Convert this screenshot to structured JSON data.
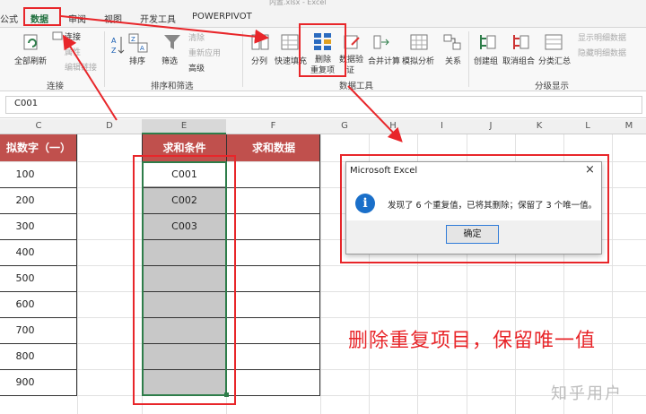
{
  "window": {
    "title": "内置.xlsx - Excel"
  },
  "tabs": [
    "公式",
    "数据",
    "审阅",
    "视图",
    "开发工具",
    "POWERPIVOT"
  ],
  "ribbon": {
    "connections": {
      "refresh_all": "全部刷新",
      "connections": "连接",
      "properties": "属性",
      "edit_links": "编辑链接",
      "group_label": "连接"
    },
    "sort_filter": {
      "sort": "排序",
      "filter": "筛选",
      "clear": "清除",
      "reapply": "重新应用",
      "advanced": "高级",
      "group_label": "排序和筛选"
    },
    "data_tools": {
      "text_to_columns": "分列",
      "flash_fill": "快速填充",
      "remove_duplicates_1": "删除",
      "remove_duplicates_2": "重复项",
      "data_validation_1": "数据验",
      "data_validation_2": "证",
      "consolidate": "合并计算",
      "what_if": "模拟分析",
      "relationships": "关系",
      "group_label": "数据工具"
    },
    "outline": {
      "group": "创建组",
      "ungroup": "取消组合",
      "subtotal": "分类汇总",
      "show_detail": "显示明细数据",
      "hide_detail": "隐藏明细数据",
      "group_label": "分级显示"
    }
  },
  "formula_bar": {
    "value": "C001"
  },
  "columns": [
    "C",
    "D",
    "E",
    "F",
    "G",
    "H",
    "I",
    "J",
    "K",
    "L",
    "M"
  ],
  "sheet": {
    "c_header": "拟数字（一）",
    "c_values": [
      "100",
      "200",
      "300",
      "400",
      "500",
      "600",
      "700",
      "800",
      "900"
    ],
    "e_header": "求和条件",
    "f_header": "求和数据",
    "e_values": [
      "C001",
      "C002",
      "C003"
    ]
  },
  "dialog": {
    "title": "Microsoft Excel",
    "close": "×",
    "info_glyph": "i",
    "message": "发现了 6 个重复值，已将其删除；保留了 3 个唯一值。",
    "ok": "确定"
  },
  "caption": "删除重复项目，保留唯一值",
  "watermark": "知乎用户",
  "colors": {
    "header_red": "#c0504d",
    "annotation_red": "#e8262a",
    "excel_green": "#1e6e3c",
    "selection_grey": "#c8c8c8"
  }
}
